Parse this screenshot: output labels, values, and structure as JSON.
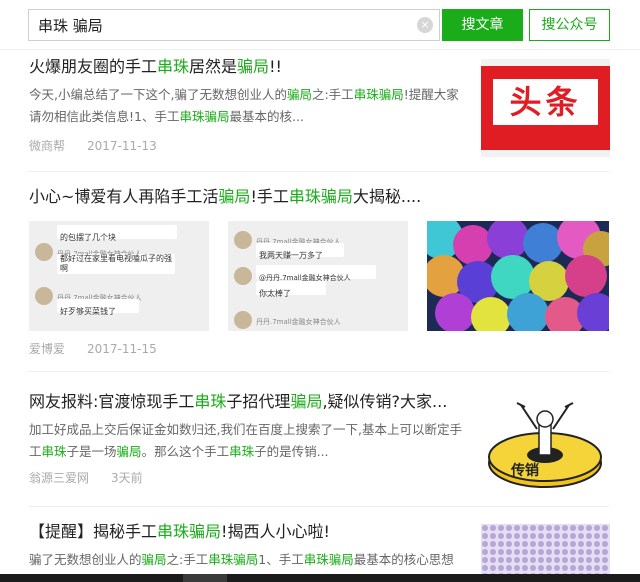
{
  "search": {
    "query": "串珠 骗局",
    "clear_icon": "×",
    "button_articles": "搜文章",
    "button_accounts": "搜公众号"
  },
  "results": [
    {
      "title_parts": [
        "火爆朋友圈的手工",
        "串珠",
        "居然是",
        "骗局",
        "!!"
      ],
      "desc_parts": [
        "今天,小编总结了一下这个,骗了无数想创业人的",
        "骗局",
        "之:手工",
        "串珠骗局",
        "!提醒大家请勿相信此类信息!1、手工",
        "串珠骗局",
        "最基本的核..."
      ],
      "source": "微商帮",
      "date": "2017-11-13",
      "thumb_text": "头条"
    },
    {
      "title_parts": [
        "小心~博爱有人再陷手工活",
        "骗局",
        "!手工",
        "串珠骗局",
        "大揭秘...."
      ],
      "source": "爱博爱",
      "date": "2017-11-15"
    },
    {
      "title_parts": [
        "网友报料:官渡惊现手工",
        "串珠",
        "子招代理",
        "骗局",
        ",疑似传销?大家..."
      ],
      "desc_parts": [
        "加工好成品上交后保证金如数归还,我们在百度上搜索了一下,基本上可以断定手工",
        "串珠",
        "子是一场",
        "骗局",
        "。那么这个手工",
        "串珠",
        "子的是传销..."
      ],
      "source": "翁源三爱网",
      "date": "3天前"
    },
    {
      "title_parts": [
        "【提醒】揭秘手工",
        "串珠骗局",
        "!揭西人小心啦!"
      ],
      "desc_parts": [
        "骗了无数想创业人的",
        "骗局",
        "之:手工",
        "串珠骗局",
        "1、手工",
        "串珠骗局",
        "最基本的核心思想"
      ]
    }
  ],
  "chat_images": [
    {
      "lines": [
        "的包摆了几个块",
        "丹丹.7mall金融女神合伙人",
        "都好过在家里看电视嗑瓜子的强啊",
        "丹丹.7mall金融女神合伙人",
        "好歹够买菜钱了"
      ]
    },
    {
      "lines": [
        "丹丹.7mall金融女神合伙人",
        "我两天赚一万多了",
        "@丹丹.7mall金融女神合伙人",
        "你太棒了",
        "丹丹.7mall金融女神合伙人"
      ]
    }
  ],
  "thumb3_text": "传销",
  "colors": {
    "accent": "#1aad19",
    "headline_red": "#e11d24"
  }
}
